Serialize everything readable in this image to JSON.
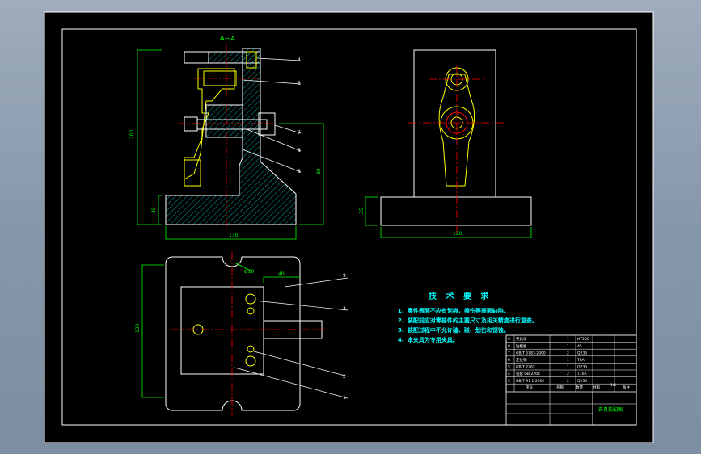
{
  "section_label": "A—A",
  "balloons_top": [
    "4",
    "5",
    "7",
    "6",
    "8"
  ],
  "balloons_bottom": [
    "9",
    "3",
    "2",
    "1"
  ],
  "dimensions": {
    "top_height": "200",
    "top_base_h": "35",
    "top_width": "130",
    "top_boss_h": "80",
    "side_width": "120",
    "side_base_h": "35",
    "plan_height": "130",
    "plan_inner": "40",
    "plan_hole": "Ø10"
  },
  "tech": {
    "title": "技 术 要 求",
    "items": [
      "1、零件表面不应有划痕，擦伤等表面缺陷。",
      "2、装配前应对零部件的主要尺寸及相关精度进行复查。",
      "3、装配过程中不允许磕、碰、划伤和锈蚀。",
      "4、本夹具为专用夹具。"
    ]
  },
  "title_block": {
    "rows": [
      [
        "9",
        "夹具体",
        "1",
        "HT200"
      ],
      [
        "8",
        "钻模板",
        "1",
        "45"
      ],
      [
        "7",
        "GB/T 5783-2000",
        "2",
        "Q235"
      ],
      [
        "6",
        "定位销",
        "1",
        "T8A"
      ],
      [
        "5",
        "GB/T 2262",
        "1",
        "Q235"
      ],
      [
        "4",
        "钻套 GB 2264",
        "2",
        "T10A"
      ],
      [
        "3",
        "GB/T 97.1-2002",
        "2",
        "Q235"
      ]
    ],
    "header": [
      "序号",
      "名称",
      "数量",
      "材料",
      "备注"
    ],
    "drawing_name": "夹具装配图",
    "scale": "1:1"
  },
  "colors": {
    "background": "#000000",
    "frame": "#ffffff",
    "outline": "#ffffff",
    "dimension": "#00ff00",
    "centerline": "#ff0000",
    "hatch": "#00cccc",
    "part": "#ffff00",
    "notes": "#00ffff",
    "leader": "#ffffff"
  }
}
